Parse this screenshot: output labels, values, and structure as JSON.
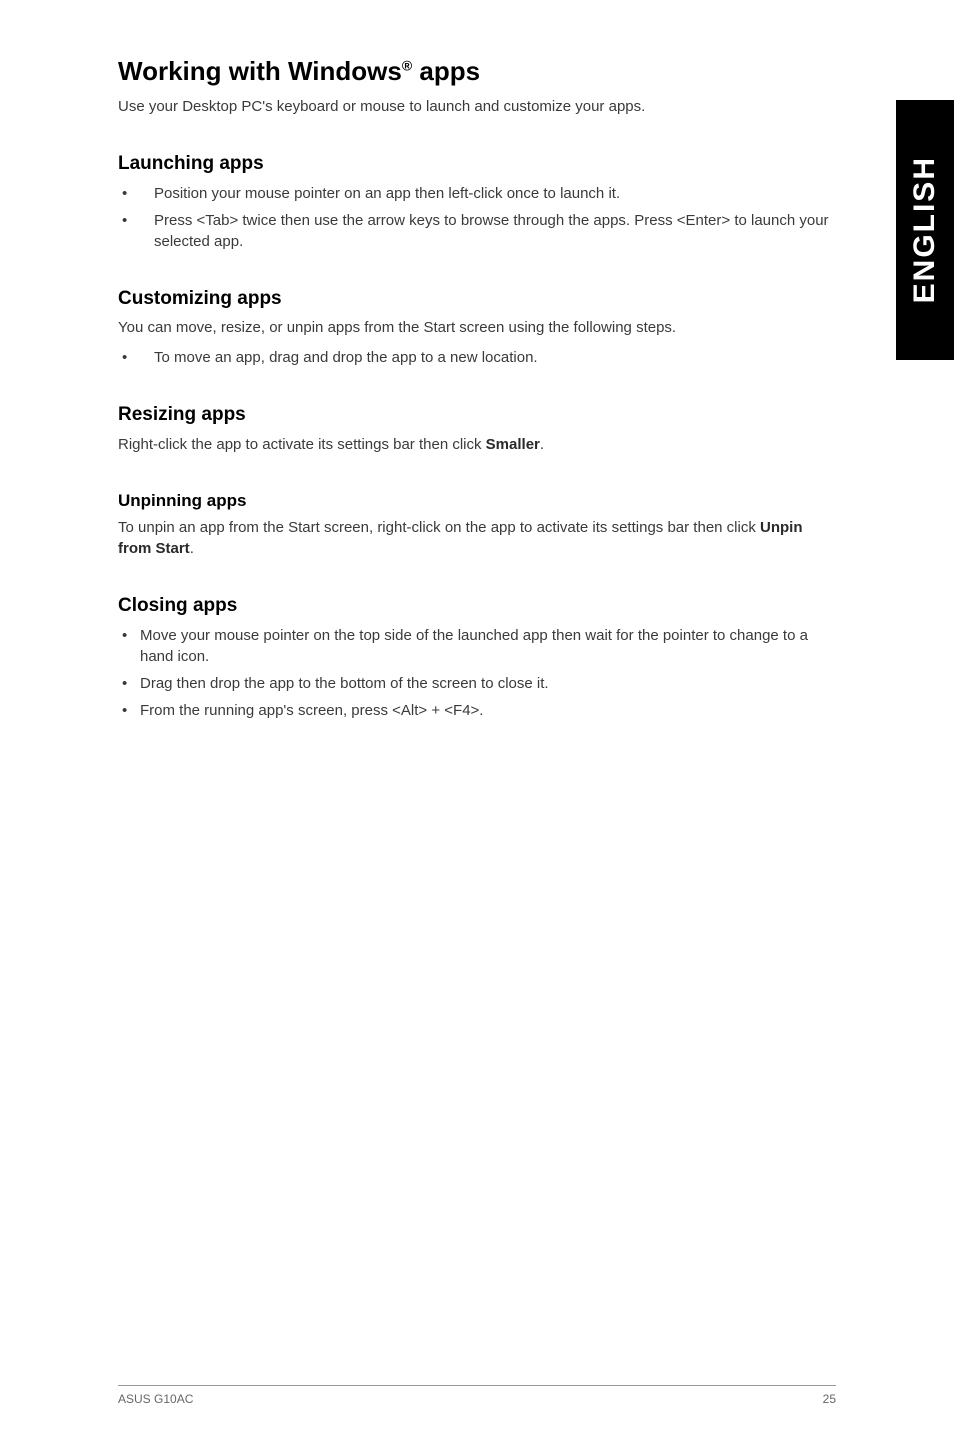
{
  "side_tab": "ENGLISH",
  "title_pre": "Working with Windows",
  "title_sup": "®",
  "title_post": " apps",
  "intro": "Use your Desktop PC's keyboard or mouse to launch and customize your apps.",
  "launching": {
    "heading": "Launching apps",
    "items": [
      "Position your mouse pointer on an app then left-click once to launch it.",
      "Press <Tab> twice then use the arrow keys to browse through the apps. Press <Enter> to launch your selected app."
    ]
  },
  "customizing": {
    "heading": "Customizing apps",
    "subintro": "You can move, resize, or unpin apps from the Start screen using the following steps.",
    "items": [
      "To move an app, drag and drop the app to a new location."
    ]
  },
  "resizing": {
    "heading": "Resizing apps",
    "para_pre": "Right-click the app to activate its settings bar then click ",
    "para_bold": "Smaller",
    "para_post": "."
  },
  "unpinning": {
    "heading": "Unpinning apps",
    "para_pre": "To unpin an app from the Start screen, right-click on the app to activate its settings bar then click ",
    "para_bold": "Unpin from Start",
    "para_post": "."
  },
  "closing": {
    "heading": "Closing apps",
    "items": [
      "Move your mouse pointer on the top side of the launched app then wait for the pointer to change to a hand icon.",
      "Drag then drop the app to the bottom of the screen to close it.",
      "From the running app's screen, press <Alt> + <F4>."
    ]
  },
  "footer": {
    "left": "ASUS G10AC",
    "right": "25"
  }
}
